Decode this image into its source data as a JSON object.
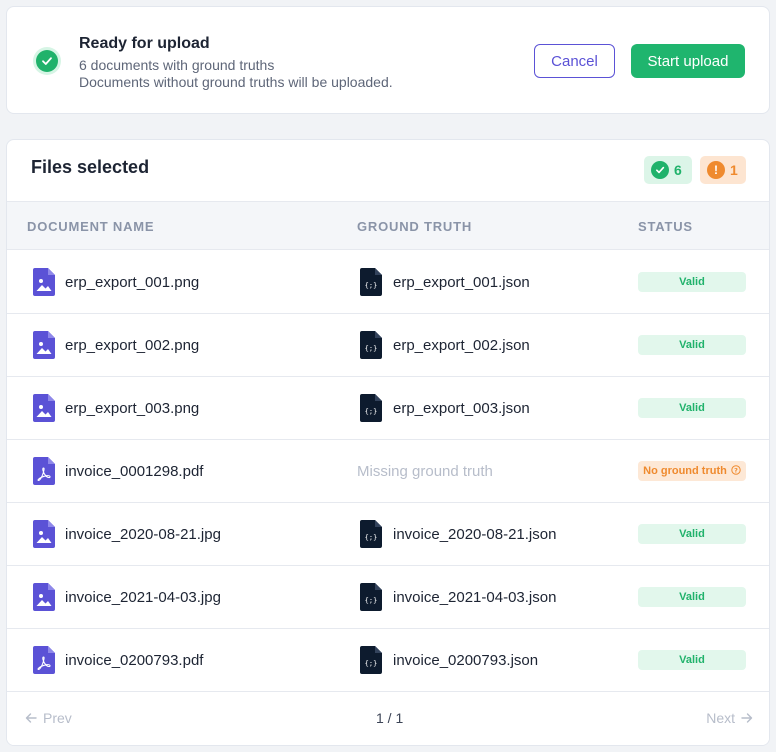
{
  "banner": {
    "title": "Ready for upload",
    "subtitle_line1": "6 documents with ground truths",
    "subtitle_line2": "Documents without ground truths will be uploaded.",
    "cancel_label": "Cancel",
    "start_label": "Start upload"
  },
  "files": {
    "title": "Files selected",
    "valid_count": "6",
    "warning_count": "1",
    "columns": {
      "document": "DOCUMENT NAME",
      "ground_truth": "GROUND TRUTH",
      "status": "STATUS"
    },
    "rows": [
      {
        "doc": "erp_export_001.png",
        "doc_type": "image",
        "gt": "erp_export_001.json",
        "status": "Valid"
      },
      {
        "doc": "erp_export_002.png",
        "doc_type": "image",
        "gt": "erp_export_002.json",
        "status": "Valid"
      },
      {
        "doc": "erp_export_003.png",
        "doc_type": "image",
        "gt": "erp_export_003.json",
        "status": "Valid"
      },
      {
        "doc": "invoice_0001298.pdf",
        "doc_type": "pdf",
        "gt_missing": "Missing ground truth",
        "status": "No ground truth"
      },
      {
        "doc": "invoice_2020-08-21.jpg",
        "doc_type": "image",
        "gt": "invoice_2020-08-21.json",
        "status": "Valid"
      },
      {
        "doc": "invoice_2021-04-03.jpg",
        "doc_type": "image",
        "gt": "invoice_2021-04-03.json",
        "status": "Valid"
      },
      {
        "doc": "invoice_0200793.pdf",
        "doc_type": "pdf",
        "gt": "invoice_0200793.json",
        "status": "Valid"
      }
    ]
  },
  "pager": {
    "prev_label": "Prev",
    "page_label": "1 / 1",
    "next_label": "Next"
  },
  "colors": {
    "accent": "#5b52d6",
    "success": "#1fb56e",
    "warning": "#ef8a2e"
  }
}
